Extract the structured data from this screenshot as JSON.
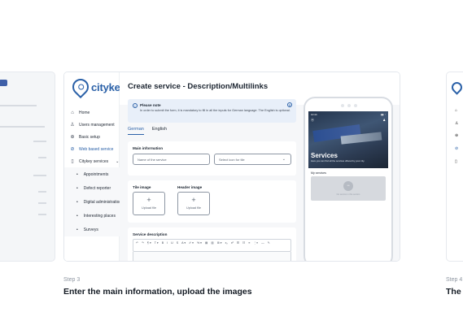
{
  "app": {
    "logo_text": "citykey",
    "page_title": "Create service - Description/Multilinks"
  },
  "sidebar": {
    "items": [
      {
        "label": "Home",
        "icon": "home-icon"
      },
      {
        "label": "Users management",
        "icon": "users-icon"
      },
      {
        "label": "Basic setup",
        "icon": "settings-icon"
      },
      {
        "label": "Web based service",
        "icon": "link-icon",
        "active": true
      },
      {
        "label": "Citykey services",
        "icon": "phone-icon",
        "expanded": true
      }
    ],
    "subitems": [
      {
        "label": "Appointments"
      },
      {
        "label": "Defect reporter"
      },
      {
        "label": "Digital administration"
      },
      {
        "label": "Interesting places"
      },
      {
        "label": "Surveys"
      }
    ]
  },
  "note": {
    "title": "Please note",
    "body": "In order to submit the form, it is mandatory to fill in all the inputs for German language. The English is optional."
  },
  "tabs": [
    {
      "label": "German",
      "active": true
    },
    {
      "label": "English",
      "active": false
    }
  ],
  "main_info": {
    "title": "Main information",
    "name_placeholder": "Name of the service",
    "icon_placeholder": "Select icon for tile"
  },
  "images": {
    "tile_label": "Tile image",
    "header_label": "Header image",
    "upload_label": "Upload file"
  },
  "description": {
    "title": "Service description",
    "toolbar": [
      "↶",
      "↷",
      "¶ ▾",
      "T ▾",
      "B",
      "I",
      "U",
      "S",
      "A ▾",
      "✐ ▾",
      "% ▾",
      "▤",
      "▥",
      "⊞ ▾",
      "x₂",
      "x²",
      "☰",
      "☷",
      "≡",
      "⋮≡",
      "—",
      "✎"
    ]
  },
  "phone": {
    "time": "10:44",
    "title": "Services",
    "subtitle": "Here you can find all the services offered by your city.",
    "my_services": "My services",
    "empty_text": "No service in this section"
  },
  "caption": {
    "step": "Step 3",
    "title": "Enter the main information, upload the images"
  },
  "next_caption": {
    "step": "Step 4",
    "title": "The"
  },
  "colors": {
    "brand": "#2b61a8",
    "note_bg": "#e8eff9"
  }
}
